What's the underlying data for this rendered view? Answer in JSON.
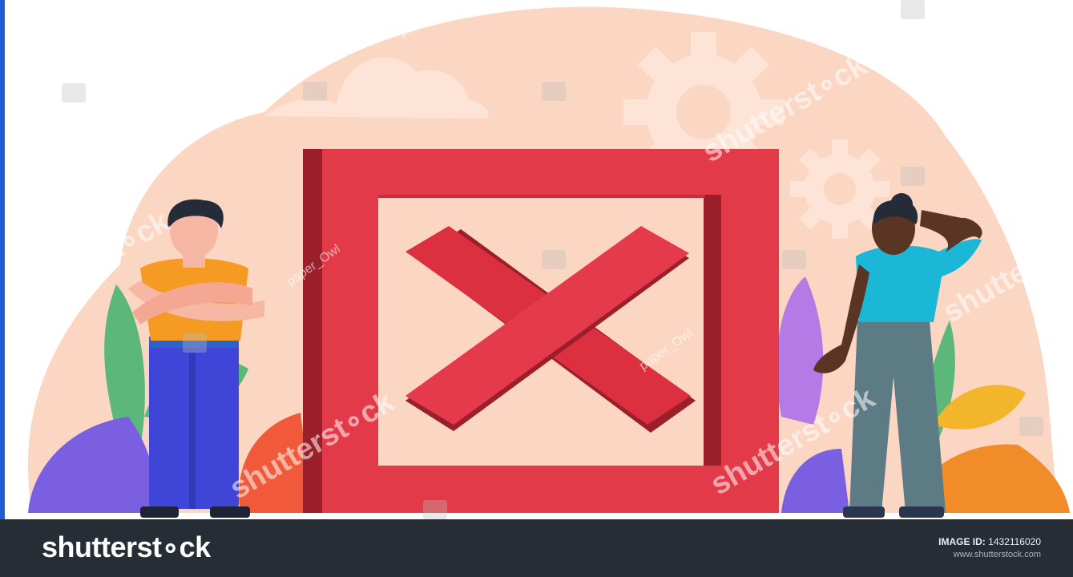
{
  "illustration": {
    "subject": "Two people standing beside a large red square frame containing a red X mark",
    "colors": {
      "background_blob": "#fbd6c2",
      "frame_red": "#e23a48",
      "frame_dark": "#9b1f2b",
      "x_mark": "#dc2f40",
      "man_shirt": "#f59a23",
      "man_pants": "#3f45d6",
      "woman_shirt": "#1ab8d6",
      "woman_pants": "#5d7b85",
      "woman_skin": "#5a3524",
      "man_skin": "#f6b8a4",
      "plant_green": "#5cb87a",
      "plant_purple": "#7a5fe0",
      "plant_orange": "#f28c28",
      "plant_red": "#f05a3a",
      "plant_yellow": "#f2b52c"
    }
  },
  "watermarks": {
    "brand": "shutterst∘ck",
    "author": "paper_Owl",
    "author_2": "paper_Owl",
    "author_3": "paper_ow"
  },
  "footer": {
    "logo_text": "shutterst∘ck",
    "image_id_label": "IMAGE ID:",
    "image_id_value": "1432116020",
    "url": "www.shutterstock.com"
  }
}
